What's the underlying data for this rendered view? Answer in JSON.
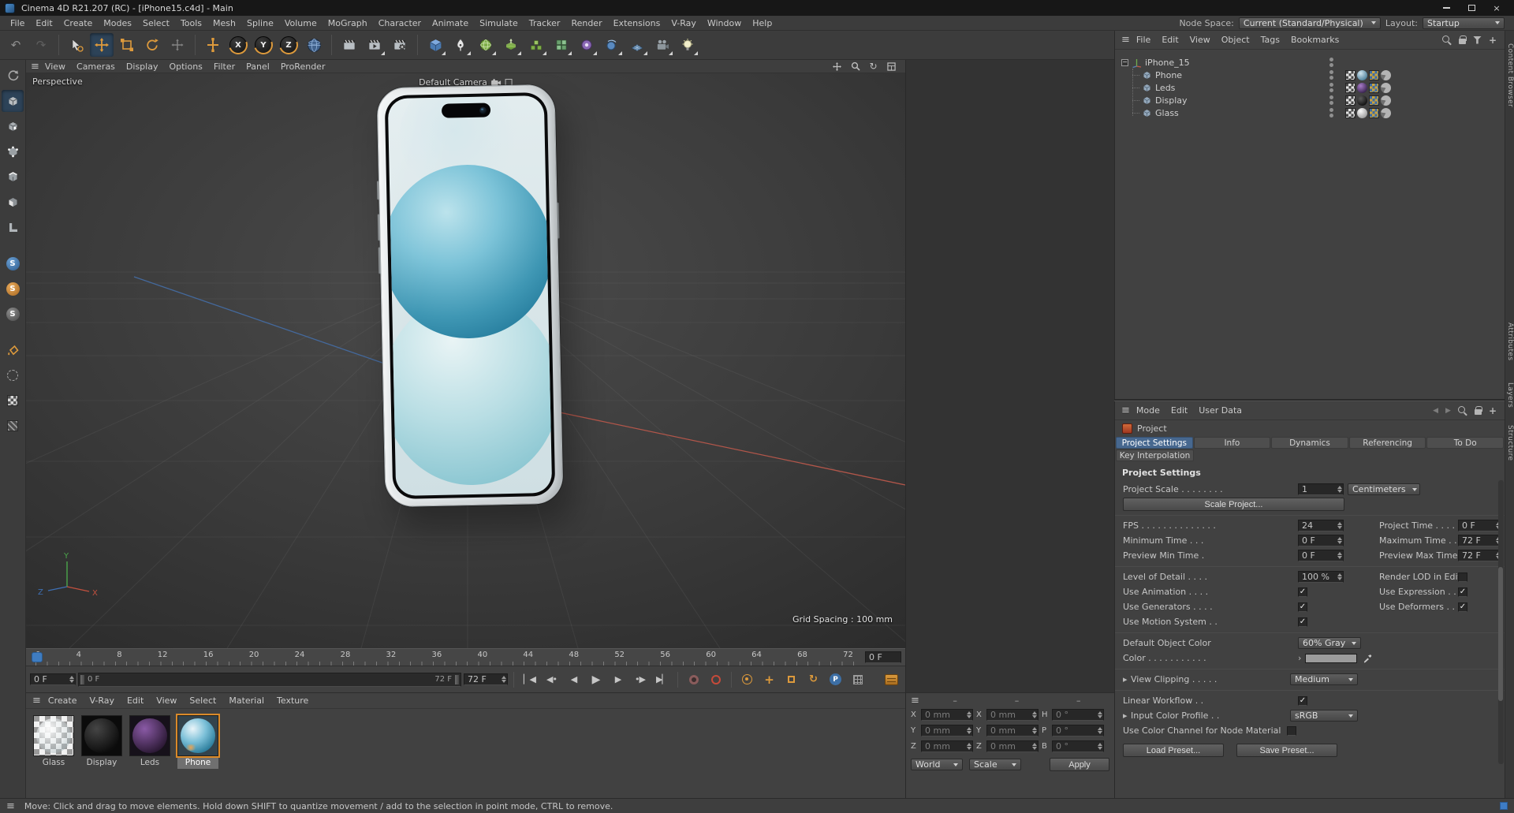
{
  "glyphs": {
    "hamburger": "≡",
    "close": "×",
    "undo": "↶",
    "redo": "↷",
    "goto_start": "▏◀",
    "prev_key": "◀•",
    "prev_frame": "◀",
    "play": "▶",
    "next_frame": "▶",
    "next_key": "•▶",
    "goto_end": "▶▏",
    "rotate": "↻",
    "expander_open": "−",
    "gutter_arrow": "▸",
    "color_expand": "›",
    "plus": "+",
    "param": "P",
    "snap_s": "S",
    "nav_back": "◀",
    "nav_fwd": "▶"
  },
  "window": {
    "title": "Cinema 4D R21.207 (RC) - [iPhone15.c4d] - Main"
  },
  "menubar": {
    "items": [
      "File",
      "Edit",
      "Create",
      "Modes",
      "Select",
      "Tools",
      "Mesh",
      "Spline",
      "Volume",
      "MoGraph",
      "Character",
      "Animate",
      "Simulate",
      "Tracker",
      "Render",
      "Extensions",
      "V-Ray",
      "Window",
      "Help"
    ],
    "node_space_label": "Node Space:",
    "node_space_value": "Current (Standard/Physical)",
    "layout_label": "Layout:",
    "layout_value": "Startup"
  },
  "toolbar": {
    "axis_locks": [
      "X",
      "Y",
      "Z"
    ]
  },
  "viewport": {
    "menus": [
      "View",
      "Cameras",
      "Display",
      "Options",
      "Filter",
      "Panel",
      "ProRender"
    ],
    "view_name": "Perspective",
    "camera_label": "Default Camera",
    "grid_spacing": "Grid Spacing : 100 mm",
    "axis_x": "X",
    "axis_y": "Y",
    "axis_z": "Z"
  },
  "timeline": {
    "ticks": [
      "0",
      "4",
      "8",
      "12",
      "16",
      "20",
      "24",
      "28",
      "32",
      "36",
      "40",
      "44",
      "48",
      "52",
      "56",
      "60",
      "64",
      "68",
      "72"
    ],
    "ruler_current": "0 F",
    "current_frame": "0 F",
    "range_start": "0 F",
    "range_end": "72 F",
    "end_frame": "72 F"
  },
  "materials": {
    "menus": [
      "Create",
      "V-Ray",
      "Edit",
      "View",
      "Select",
      "Material",
      "Texture"
    ],
    "items": [
      {
        "name": "Glass"
      },
      {
        "name": "Display"
      },
      {
        "name": "Leds"
      },
      {
        "name": "Phone"
      }
    ]
  },
  "coordinates": {
    "headers": [
      "–",
      "–",
      "–"
    ],
    "pos_labels": [
      "X",
      "Y",
      "Z"
    ],
    "size_labels": [
      "X",
      "Y",
      "Z"
    ],
    "rot_labels": [
      "H",
      "P",
      "B"
    ],
    "pos_values": [
      "0 mm",
      "0 mm",
      "0 mm"
    ],
    "size_values": [
      "0 mm",
      "0 mm",
      "0 mm"
    ],
    "rot_values": [
      "0 °",
      "0 °",
      "0 °"
    ],
    "space": "World",
    "mode": "Scale",
    "apply": "Apply"
  },
  "object_manager": {
    "menus": [
      "File",
      "Edit",
      "View",
      "Object",
      "Tags",
      "Bookmarks"
    ],
    "objects": [
      {
        "name": "iPhone_15"
      },
      {
        "name": "Phone"
      },
      {
        "name": "Leds"
      },
      {
        "name": "Display"
      },
      {
        "name": "Glass"
      }
    ]
  },
  "attributes": {
    "menus": [
      "Mode",
      "Edit",
      "User Data"
    ],
    "object_name": "Project",
    "tabs": [
      "Project Settings",
      "Info",
      "Dynamics",
      "Referencing",
      "To Do"
    ],
    "tab_row2": "Key Interpolation",
    "section": "Project Settings",
    "project_scale": {
      "label": "Project Scale . . . . . . . .",
      "value": "1",
      "unit": "Centimeters"
    },
    "scale_project": "Scale Project...",
    "fps": {
      "label": "FPS . . . . . . . . . . . . . .",
      "value": "24"
    },
    "project_time": {
      "label": "Project Time . . . . .",
      "value": "0 F"
    },
    "minimum_time": {
      "label": "Minimum Time . . .",
      "value": "0 F"
    },
    "maximum_time": {
      "label": "Maximum Time . .",
      "value": "72 F"
    },
    "preview_min_time": {
      "label": "Preview Min Time .",
      "value": "0 F"
    },
    "preview_max_time": {
      "label": "Preview Max Time .",
      "value": "72 F"
    },
    "level_of_detail": {
      "label": "Level of Detail . . . .",
      "value": "100 %"
    },
    "render_lod": {
      "label": "Render LOD in Editor",
      "mark": ""
    },
    "use_animation": {
      "label": "Use Animation . . . .",
      "mark": "✓"
    },
    "use_expression": {
      "label": "Use Expression . . . .",
      "mark": "✓"
    },
    "use_generators": {
      "label": "Use Generators . . . .",
      "mark": "✓"
    },
    "use_deformers": {
      "label": "Use Deformers . . . .",
      "mark": "✓"
    },
    "use_motion_system": {
      "label": "Use Motion System . .",
      "mark": "✓"
    },
    "default_object_color": {
      "label": "Default Object Color",
      "value": "60% Gray"
    },
    "color": {
      "label": "Color . . . . . . . . . . ."
    },
    "view_clipping": {
      "label": "View Clipping . . . . .",
      "value": "Medium"
    },
    "linear_workflow": {
      "label": "Linear Workflow . .",
      "mark": "✓"
    },
    "input_color_profile": {
      "label": "Input Color Profile . .",
      "value": "sRGB"
    },
    "use_color_channel": {
      "label": "Use Color Channel for Node Material",
      "mark": ""
    },
    "load_preset": "Load Preset...",
    "save_preset": "Save Preset..."
  },
  "side_tabs": [
    "Content Browser",
    "Attributes",
    "Layers",
    "Structure"
  ],
  "statusbar": {
    "text": "Move: Click and drag to move elements. Hold down SHIFT to quantize movement / add to the selection in point mode, CTRL to remove."
  }
}
